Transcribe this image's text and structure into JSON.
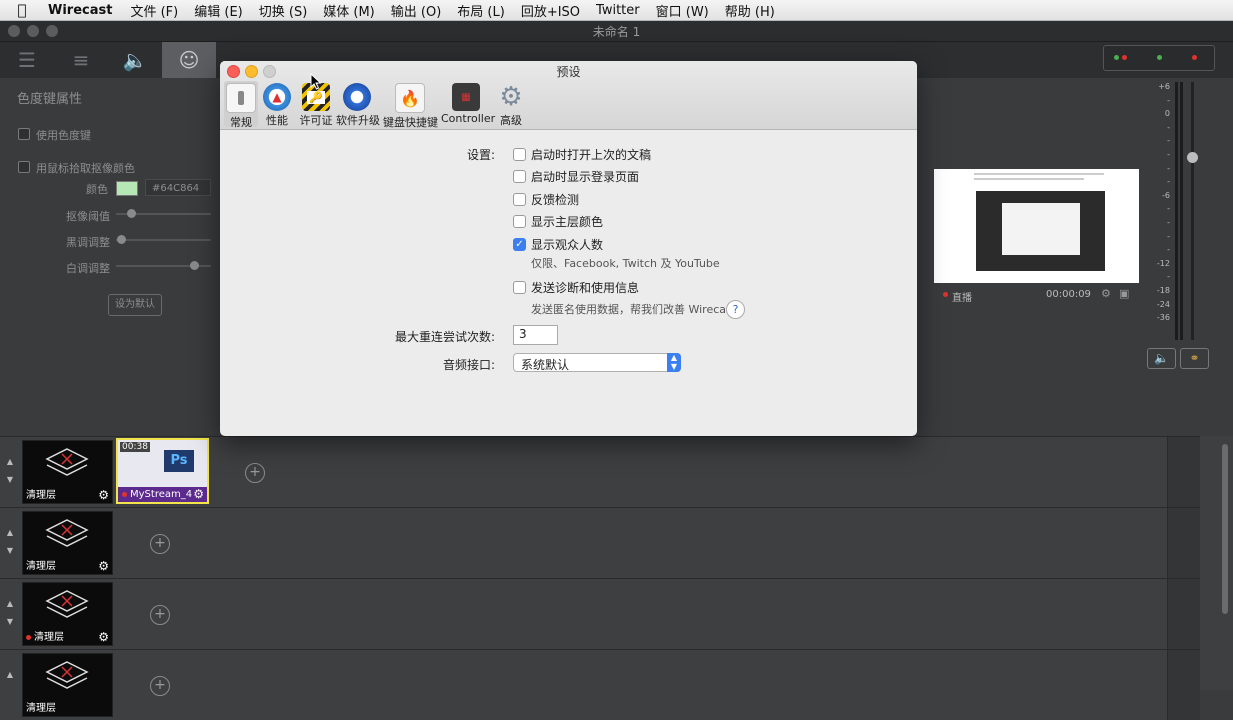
{
  "menubar": {
    "app": "Wirecast",
    "items": [
      "文件 (F)",
      "编辑 (E)",
      "切换 (S)",
      "媒体 (M)",
      "输出 (O)",
      "布局 (L)",
      "回放+ISO",
      "Twitter",
      "窗口 (W)",
      "帮助 (H)"
    ]
  },
  "window": {
    "title": "未命名 1"
  },
  "left_panel": {
    "title": "色度键属性",
    "use_chroma": "使用色度键",
    "pick_color": "用鼠标拾取抠像颜色",
    "color_label": "颜色",
    "color_value": "#64C864",
    "threshold_label": "抠像阈值",
    "hue_label": "黑调调整",
    "white_label": "白调调整",
    "default_button": "设为默认"
  },
  "dialog": {
    "title": "预设",
    "tabs": [
      {
        "label": "常规",
        "icon": "switch-icon"
      },
      {
        "label": "性能",
        "icon": "gauge-icon"
      },
      {
        "label": "许可证",
        "icon": "license-icon"
      },
      {
        "label": "软件升级",
        "icon": "update-icon"
      },
      {
        "label": "键盘快捷键",
        "icon": "keyboard-shortcut-icon"
      },
      {
        "label": "Controller",
        "icon": "controller-icon"
      },
      {
        "label": "高级",
        "icon": "gear-icon"
      }
    ],
    "settings_label": "设置:",
    "options": [
      {
        "label": "启动时打开上次的文稿",
        "checked": false
      },
      {
        "label": "启动时显示登录页面",
        "checked": false
      },
      {
        "label": "反馈检测",
        "checked": false
      },
      {
        "label": "显示主层颜色",
        "checked": false
      },
      {
        "label": "显示观众人数",
        "checked": true
      },
      {
        "label": "发送诊断和使用信息",
        "checked": false
      }
    ],
    "viewer_note": "仅限、Facebook, Twitch 及 YouTube",
    "diag_note": "发送匿名使用数据，帮我们改善 Wirecast",
    "help_symbol": "?",
    "retry_label": "最大重连尝试次数:",
    "retry_value": "3",
    "audio_label": "音频接口:",
    "audio_value": "系统默认"
  },
  "preview": {
    "live_label": "直播",
    "time": "00:00:09"
  },
  "meter_ticks": [
    "+6",
    "-",
    "0",
    "-",
    "-",
    "-",
    "-",
    "-",
    "-6",
    "-",
    "-",
    "-",
    "-",
    "-12",
    "-",
    "-18",
    "-24",
    "-36"
  ],
  "shots": {
    "rows": [
      {
        "items": [
          {
            "name": "清理层",
            "dot": false
          },
          {
            "name": "MyStream_4",
            "dot": true,
            "selected": true,
            "timecode": "00:38"
          }
        ]
      },
      {
        "items": [
          {
            "name": "清理层",
            "dot": false
          }
        ]
      },
      {
        "items": [
          {
            "name": "清理层",
            "dot": true
          }
        ]
      },
      {
        "items": [
          {
            "name": "清理层",
            "dot": false
          }
        ]
      }
    ]
  },
  "colors": {
    "accent": "#3c7ff0",
    "chroma_swatch": "#b6e8b6",
    "live_red": "#e0322e"
  }
}
